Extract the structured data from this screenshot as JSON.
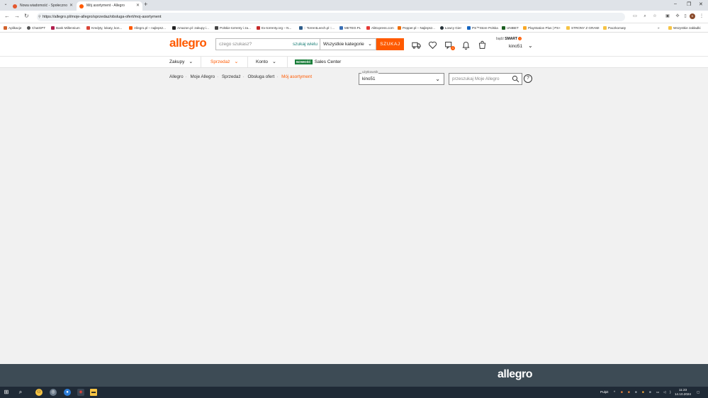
{
  "browser": {
    "tabs": [
      {
        "title": "Nowa wiadomość - Społeczno",
        "favicon_color": "#e4572e"
      },
      {
        "title": "Mój asortyment - Allegro",
        "favicon_color": "#ff5a00"
      }
    ],
    "new_tab": "+",
    "url": "https://allegro.pl/moje-allegro/sprzedaz/obsluga-ofert/moj-asortyment",
    "bookmarks": [
      {
        "label": "Aplikacje",
        "color": "#d2622b"
      },
      {
        "label": "ChatGPT",
        "color": "#555555"
      },
      {
        "label": "Bank Millennium",
        "color": "#b11e4d"
      },
      {
        "label": "Kredyty, lokaty, kon...",
        "color": "#d94437"
      },
      {
        "label": "Allegro.pl – najlepsz...",
        "color": "#ff5a00"
      },
      {
        "label": "Amazon.pl: zakupy i...",
        "color": "#222222"
      },
      {
        "label": "Polskie torrenty i za...",
        "color": "#444444"
      },
      {
        "label": "Ex-torrenty.org – N...",
        "color": "#c62828"
      },
      {
        "label": ":: TorrentLeech.pl ::...",
        "color": "#2e5d8a"
      },
      {
        "label": "METEO.PL",
        "color": "#3a6fb5"
      },
      {
        "label": "AliExpress.com",
        "color": "#e53935"
      },
      {
        "label": "Pepper.pl – Najlepsz...",
        "color": "#ef6c00"
      },
      {
        "label": "Łowcy Gier",
        "color": "#263238"
      },
      {
        "label": "PS™Store Polska",
        "color": "#1565c0"
      },
      {
        "label": "UNIBET",
        "color": "#1b5e20"
      },
      {
        "label": "PlayStation Plus | PS+",
        "color": "#f9a825"
      },
      {
        "label": "STRONY Z GRAMI",
        "color": "#f6c343"
      },
      {
        "label": "Paczkomaty",
        "color": "#f6c343"
      }
    ],
    "more_bookmarks": "»",
    "all_bookmarks": "Wszystkie zakładki"
  },
  "header": {
    "logo": "allegro",
    "search_placeholder": "czego szukasz?",
    "search_multi": "szukaj wielu",
    "category": "Wszystkie kategorie",
    "search_button": "SZUKAJ",
    "notifications_badge": "1",
    "smart_prefix": "bądź",
    "smart_label": "SMART",
    "smart_badge": "!",
    "username": "kino51"
  },
  "subnav": {
    "items": [
      "Zakupy",
      "Sprzedaż",
      "Konto"
    ],
    "new_badge": "NOWOŚĆ",
    "sales_center": "Sales Center"
  },
  "breadcrumb": [
    "Allegro",
    "Moje Allegro",
    "Sprzedaż",
    "Obsługa ofert",
    "Mój asortyment"
  ],
  "filters": {
    "user_label": "użytkownik",
    "user_value": "kino51",
    "search_placeholder": "przeszukaj Moje Allegro",
    "help": "?"
  },
  "footer": {
    "logo": "allegro"
  },
  "taskbar": {
    "desktop": "Pulpit",
    "time": "11:23",
    "date": "14.10.2024"
  },
  "colors": {
    "brand": "#ff5a00",
    "footer": "#3d4b55",
    "accent_green": "#1a7e76"
  }
}
